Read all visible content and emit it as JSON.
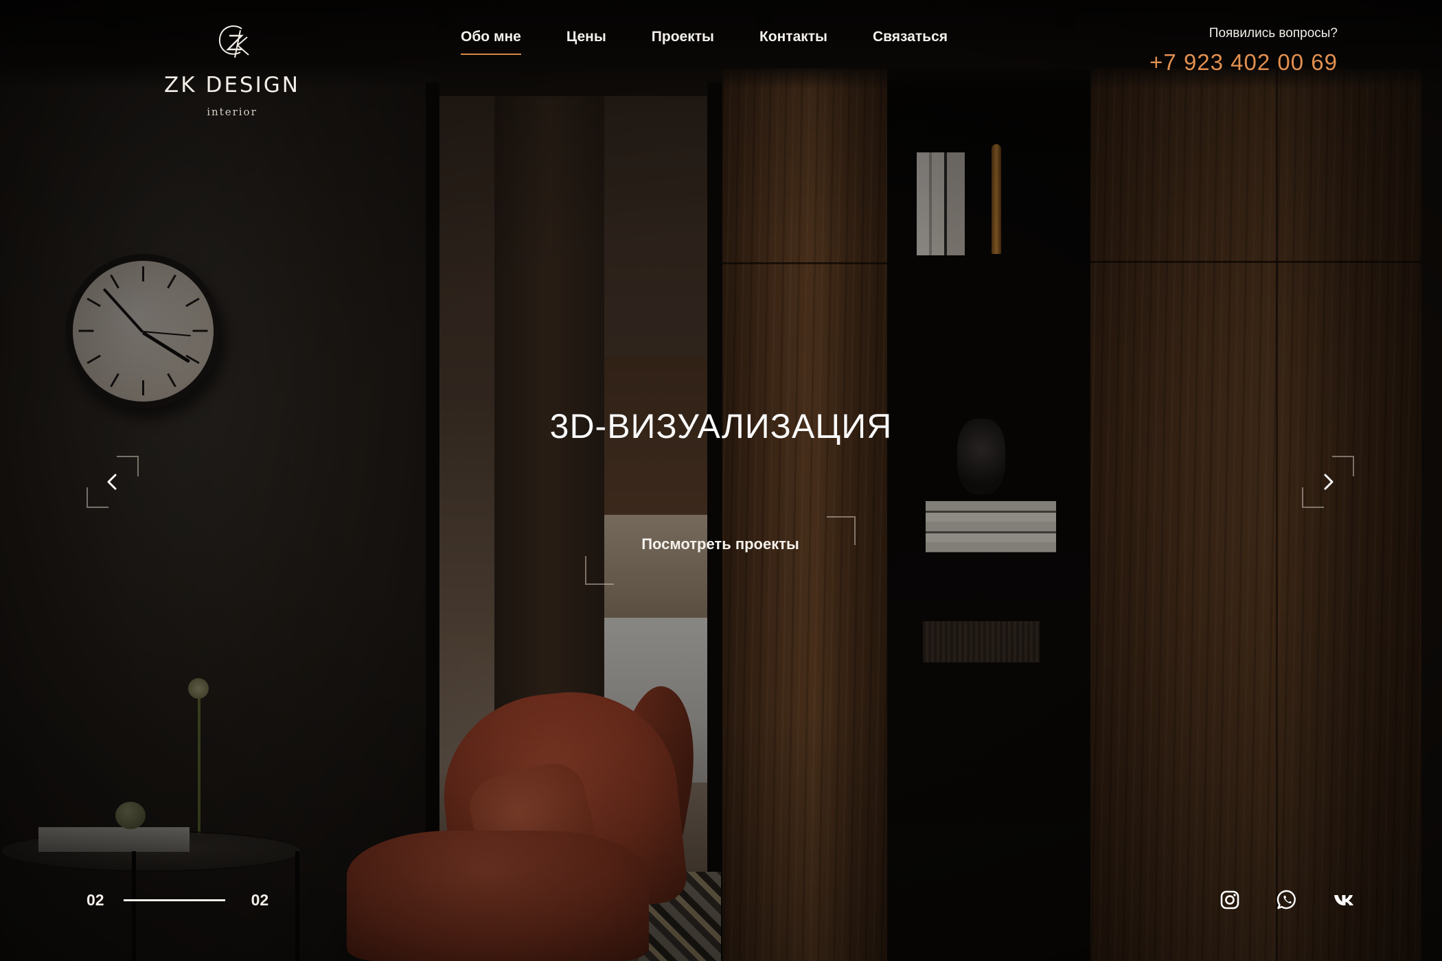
{
  "logo": {
    "name": "ZK DESIGN",
    "subtitle": "interior",
    "mark": "ZK monogram"
  },
  "nav": {
    "items": [
      {
        "label": "Обо мне",
        "active": true
      },
      {
        "label": "Цены",
        "active": false
      },
      {
        "label": "Проекты",
        "active": false
      },
      {
        "label": "Контакты",
        "active": false
      },
      {
        "label": "Связаться",
        "active": false
      }
    ]
  },
  "contact": {
    "question": "Появились вопросы?",
    "phone": "+7 923 402 00 69"
  },
  "hero": {
    "title": "3D-ВИЗУАЛИЗАЦИЯ",
    "cta_label": "Посмотреть проекты"
  },
  "slider": {
    "current": "02",
    "total": "02",
    "progress": 1.0,
    "prev_icon": "chevron-left-icon",
    "next_icon": "chevron-right-icon"
  },
  "social": [
    {
      "name": "instagram",
      "icon": "instagram-icon"
    },
    {
      "name": "whatsapp",
      "icon": "whatsapp-icon"
    },
    {
      "name": "vk",
      "icon": "vk-icon"
    }
  ],
  "colors": {
    "accent": "#e39050",
    "nav_underline": "#d98a46",
    "text": "#f5f1ec"
  }
}
